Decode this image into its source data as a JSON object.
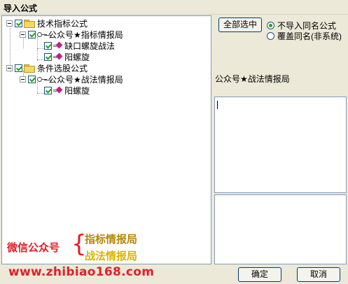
{
  "window": {
    "title": "导入公式"
  },
  "tree": [
    {
      "label": "技术指标公式",
      "type": "category",
      "checked": true,
      "icon": "folder-icon"
    },
    {
      "label": "公众号★指标情报局",
      "type": "group",
      "checked": true,
      "icon": "key-icon"
    },
    {
      "label": "缺口螺旋战法",
      "type": "formula",
      "checked": true,
      "icon": "formula-icon"
    },
    {
      "label": "阳螺旋",
      "type": "formula",
      "checked": true,
      "icon": "formula-icon"
    },
    {
      "label": "条件选股公式",
      "type": "category",
      "checked": true,
      "icon": "folder-icon"
    },
    {
      "label": "公众号★战法情报局",
      "type": "group",
      "checked": true,
      "icon": "key-icon"
    },
    {
      "label": "阳螺旋",
      "type": "formula",
      "checked": true,
      "icon": "formula-icon"
    }
  ],
  "select_all_button": "全部选中",
  "options": [
    {
      "label": "不导入同名公式",
      "selected": true
    },
    {
      "label": "覆盖同名(非系统)",
      "selected": false
    }
  ],
  "selected_name": "公众号★战法情报局",
  "description_text": "",
  "watermark": {
    "wechat": "微信公众号",
    "line1": "指标情报局",
    "line2": "战法情报局",
    "url": "www.zhibiao168.com"
  },
  "ok_button": "确定",
  "cancel_button": "取消",
  "colors": {
    "accent": "#e0202a",
    "check": "#21a121",
    "border": "#7f9db9"
  }
}
